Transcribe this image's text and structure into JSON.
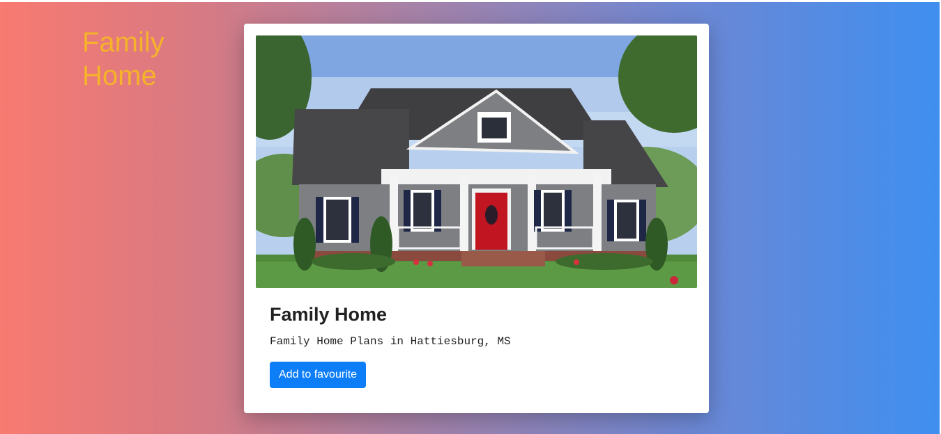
{
  "brand": {
    "title": "Family Home"
  },
  "card": {
    "image_alt": "house-photo",
    "title": "Family Home",
    "subtitle": "Family Home Plans in Hattiesburg, MS",
    "button_label": "Add to favourite"
  },
  "colors": {
    "brand_text": "#f5b22a",
    "button": "#0d7ef8",
    "gradient_start": "#f87a71",
    "gradient_end": "#3f8ff0"
  }
}
